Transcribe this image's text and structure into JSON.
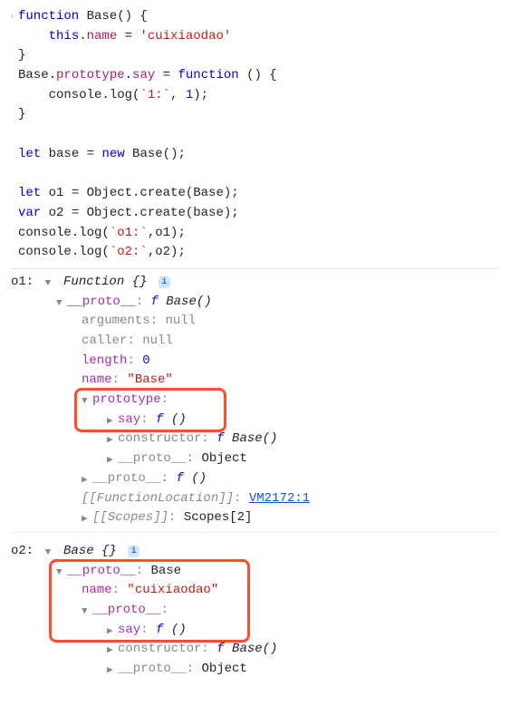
{
  "code": {
    "l1a": "function",
    "l1b": " Base() {",
    "l2a": "    ",
    "l2b": "this",
    "l2c": ".",
    "l2d": "name",
    "l2e": " = ",
    "l2f": "'cuixiaodao'",
    "l3": "}",
    "l4a": "Base.",
    "l4b": "prototype",
    "l4c": ".",
    "l4d": "say",
    "l4e": " = ",
    "l4f": "function",
    "l4g": " () {",
    "l5a": "    console.log(",
    "l5b": "`1:`",
    "l5c": ", ",
    "l5d": "1",
    "l5e": ");",
    "l6": "}",
    "blank1": "",
    "l7a": "let",
    "l7b": " base = ",
    "l7c": "new",
    "l7d": " Base();",
    "blank2": "",
    "l8a": "let",
    "l8b": " o1 = Object.create(Base);",
    "l9a": "var",
    "l9b": " o2 = Object.create(base);",
    "l10": "console.log(",
    "l10b": "`o1:`",
    "l10c": ",o1);",
    "l11": "console.log(",
    "l11b": "`o2:`",
    "l11c": ",o2);"
  },
  "o1": {
    "label": "o1: ",
    "header_class": "Function {}",
    "proto": {
      "key": "__proto__",
      "value": "f Base()",
      "arguments": {
        "key": "arguments",
        "value": "null"
      },
      "caller": {
        "key": "caller",
        "value": "null"
      },
      "length": {
        "key": "length",
        "value": "0"
      },
      "name": {
        "key": "name",
        "value": "\"Base\""
      },
      "prototype": {
        "key": "prototype",
        "say": {
          "key": "say",
          "value": "f ()"
        },
        "constructor": {
          "key": "constructor",
          "value": "f Base()"
        },
        "proto": {
          "key": "__proto__",
          "value": "Object"
        }
      },
      "proto2": {
        "key": "__proto__",
        "value": "f ()"
      },
      "funcloc": {
        "key": "[[FunctionLocation]]",
        "value": "VM2172:1"
      },
      "scopes": {
        "key": "[[Scopes]]",
        "value": "Scopes[2]"
      }
    }
  },
  "o2": {
    "label": "o2: ",
    "header_class": "Base {}",
    "proto": {
      "key": "__proto__",
      "value": "Base",
      "name": {
        "key": "name",
        "value": "\"cuixiaodao\""
      },
      "proto2": {
        "key": "__proto__",
        "say": {
          "key": "say",
          "value": "f ()"
        },
        "constructor": {
          "key": "constructor",
          "value": "f Base()"
        },
        "proto": {
          "key": "__proto__",
          "value": "Object"
        }
      }
    }
  },
  "info_glyph": "i"
}
